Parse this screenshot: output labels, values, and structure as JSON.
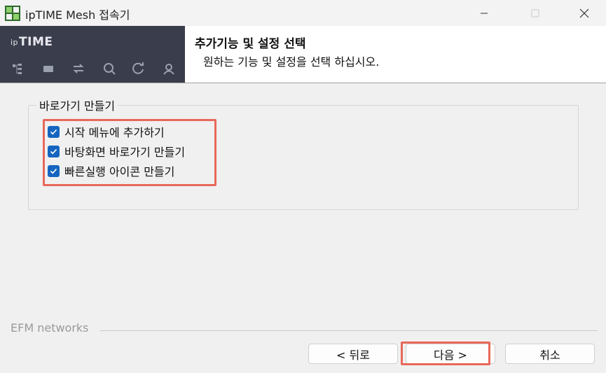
{
  "window": {
    "title": "ipTIME Mesh 접속기",
    "controls": [
      "minimize-icon",
      "maximize-icon",
      "close-icon"
    ]
  },
  "header": {
    "brand_prefix": "ip",
    "brand_name": "TIME",
    "brand_icons": [
      "network-tree-icon",
      "router-icon",
      "transfer-icon",
      "search-icon",
      "refresh-icon",
      "user-icon"
    ],
    "title": "추가기능 및 설정 선택",
    "subtitle": "원하는 기능 및 설정을 선택 하십시오."
  },
  "group": {
    "label": "바로가기 만들기",
    "options": [
      {
        "label": "시작 메뉴에 추가하기",
        "checked": true
      },
      {
        "label": "바탕화면 바로가기 만들기",
        "checked": true
      },
      {
        "label": "빠른실행 아이콘 만들기",
        "checked": true
      }
    ]
  },
  "footer": {
    "brand": "EFM networks",
    "back_label": "< 뒤로",
    "next_label": "다음 >",
    "cancel_label": "취소"
  },
  "colors": {
    "brand_panel": "#3a3e4c",
    "checkbox": "#1565c0",
    "highlight": "#e8685a"
  }
}
